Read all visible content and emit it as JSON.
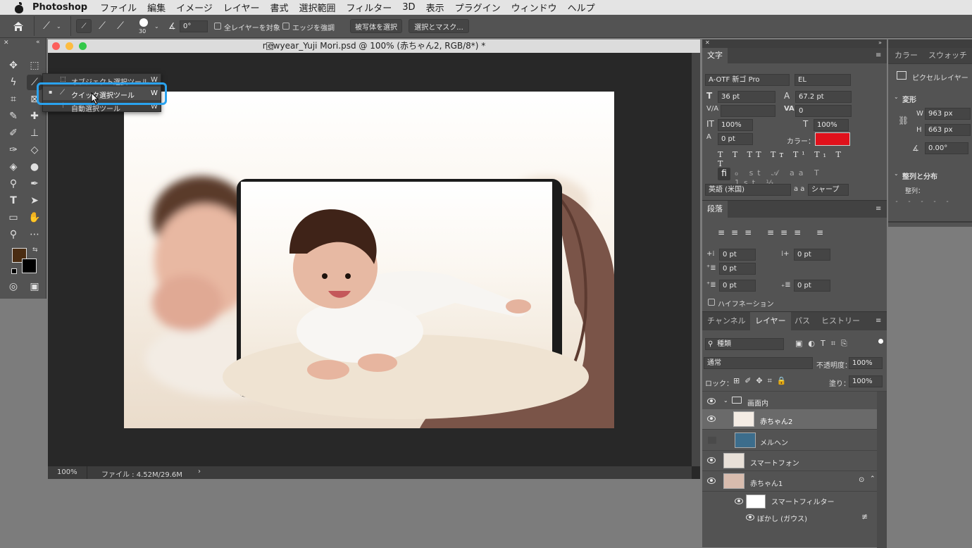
{
  "menubar": {
    "app": "Photoshop",
    "items": [
      "ファイル",
      "編集",
      "イメージ",
      "レイヤー",
      "書式",
      "選択範囲",
      "フィルター",
      "3D",
      "表示",
      "プラグイン",
      "ウィンドウ",
      "ヘルプ"
    ]
  },
  "options": {
    "brush_size": "30",
    "angle": "0°",
    "all_layers_label": "全レイヤーを対象",
    "enhance_edge_label": "エッジを強調",
    "select_subject_label": "被写体を選択",
    "select_mask_label": "選択とマスク..."
  },
  "document": {
    "title": "newyear_Yuji Mori.psd @ 100% (赤ちゃん2, RGB/8*) *",
    "zoom": "100%",
    "file_info": "ファイル : 4.52M/29.6M"
  },
  "tool_popup": {
    "items": [
      {
        "label": "オブジェクト選択ツール",
        "key": "W"
      },
      {
        "label": "クイック選択ツール",
        "key": "W"
      },
      {
        "label": "自動選択ツール",
        "key": "W"
      }
    ]
  },
  "char_panel": {
    "tab": "文字",
    "font_family": "A-OTF 新ゴ Pro",
    "font_style": "EL",
    "font_size": "36 pt",
    "leading": "67.2 pt",
    "kerning": "",
    "tracking": "0",
    "vscale": "100%",
    "hscale": "100%",
    "baseline": "0 pt",
    "color_label": "カラー：",
    "color": "#e0111b",
    "language": "英語 (米国)",
    "aa_label": "a a",
    "antialias": "シャープ"
  },
  "para_panel": {
    "tab": "段落",
    "indent_left": "0 pt",
    "indent_right": "0 pt",
    "first_line": "0 pt",
    "space_before": "0 pt",
    "space_after": "0 pt",
    "hyphenation": "ハイフネーション"
  },
  "layers_panel": {
    "tabs": [
      "チャンネル",
      "レイヤー",
      "パス",
      "ヒストリー"
    ],
    "filter_kind": "種類",
    "blend_mode": "通常",
    "opacity_label": "不透明度：",
    "opacity": "100%",
    "lock_label": "ロック：",
    "fill_label": "塗り：",
    "fill": "100%",
    "layers": [
      {
        "name": "画面内",
        "type": "group"
      },
      {
        "name": "赤ちゃん2",
        "selected": true
      },
      {
        "name": "メルヘン"
      },
      {
        "name": "スマートフォン"
      },
      {
        "name": "赤ちゃん1"
      },
      {
        "name": "スマートフィルター"
      },
      {
        "name": "ぼかし (ガウス)"
      }
    ]
  },
  "right_panel": {
    "tabs": [
      "カラー",
      "スウォッチ"
    ],
    "pixel_layer": "ピクセルレイヤー",
    "transform": "変形",
    "w_label": "W",
    "w": "963 px",
    "h_label": "H",
    "h": "663 px",
    "angle": "0.00°",
    "align": "整列と分布",
    "align_sub": "整列："
  }
}
